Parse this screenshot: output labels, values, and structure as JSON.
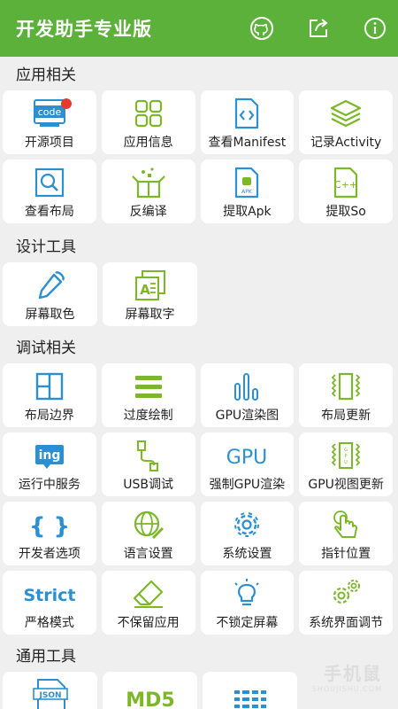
{
  "app_title": "开发助手专业版",
  "toolbar": {
    "icons": [
      "github-icon",
      "share-icon",
      "info-icon"
    ]
  },
  "colors": {
    "brand": "#5cb13a",
    "icon_green": "#7cb72a",
    "icon_blue": "#2b8fd1",
    "badge": "#e53935"
  },
  "sections": [
    {
      "title": "应用相关",
      "items": [
        {
          "label": "开源项目",
          "icon": "code-icon"
        },
        {
          "label": "应用信息",
          "icon": "grid-icon"
        },
        {
          "label": "查看Manifest",
          "icon": "xml-file-icon"
        },
        {
          "label": "记录Activity",
          "icon": "layers-icon"
        },
        {
          "label": "查看布局",
          "icon": "magnifier-icon"
        },
        {
          "label": "反编译",
          "icon": "open-box-icon"
        },
        {
          "label": "提取Apk",
          "icon": "apk-file-icon"
        },
        {
          "label": "提取So",
          "icon": "cpp-file-icon"
        }
      ]
    },
    {
      "title": "设计工具",
      "items": [
        {
          "label": "屏幕取色",
          "icon": "eyedropper-icon"
        },
        {
          "label": "屏幕取字",
          "icon": "text-capture-icon"
        }
      ]
    },
    {
      "title": "调试相关",
      "items": [
        {
          "label": "布局边界",
          "icon": "layout-bounds-icon"
        },
        {
          "label": "过度绘制",
          "icon": "stack-lines-icon"
        },
        {
          "label": "GPU渲染图",
          "icon": "bar-chart-icon"
        },
        {
          "label": "布局更新",
          "icon": "vibrate-icon"
        },
        {
          "label": "运行中服务",
          "icon": "running-service-icon",
          "icon_text": "ing"
        },
        {
          "label": "USB调试",
          "icon": "usb-icon"
        },
        {
          "label": "强制GPU渲染",
          "icon": "gpu-text-icon",
          "icon_text": "GPU"
        },
        {
          "label": "GPU视图更新",
          "icon": "gpu-chip-icon",
          "icon_text": "GPU"
        },
        {
          "label": "开发者选项",
          "icon": "braces-icon",
          "icon_text": "{ }"
        },
        {
          "label": "语言设置",
          "icon": "globe-pencil-icon"
        },
        {
          "label": "系统设置",
          "icon": "settings-gear-icon"
        },
        {
          "label": "指针位置",
          "icon": "pointer-hand-icon"
        },
        {
          "label": "严格模式",
          "icon": "strict-text-icon",
          "icon_text": "Strict"
        },
        {
          "label": "不保留应用",
          "icon": "eraser-icon"
        },
        {
          "label": "不锁定屏幕",
          "icon": "lightbulb-icon"
        },
        {
          "label": "系统界面调节",
          "icon": "gears-icon"
        }
      ]
    },
    {
      "title": "通用工具",
      "items": [
        {
          "label": "",
          "icon": "json-icon",
          "icon_text": "JSON"
        },
        {
          "label": "",
          "icon": "md5-icon",
          "icon_text": "MD5"
        },
        {
          "label": "",
          "icon": "stripes-icon"
        }
      ]
    }
  ],
  "watermark": {
    "text": "手机鼠",
    "sub": "SHOUJISHU.COM"
  }
}
